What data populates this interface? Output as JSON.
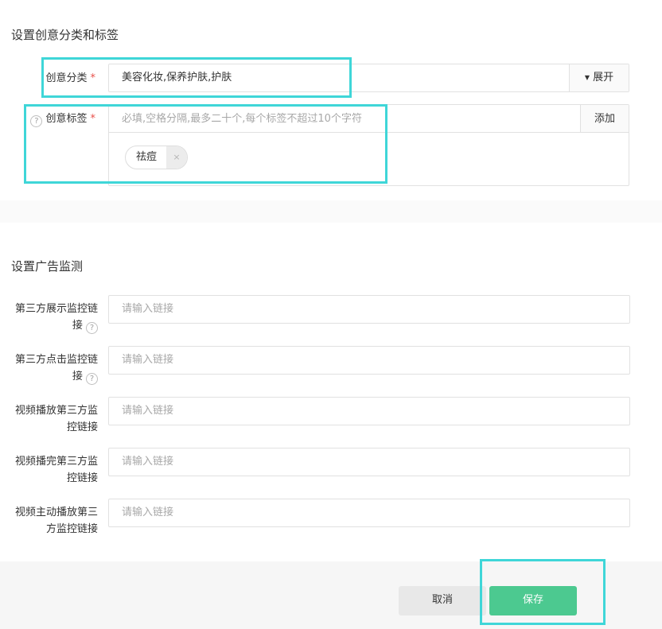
{
  "section1": {
    "title": "设置创意分类和标签",
    "category": {
      "label": "创意分类",
      "required_mark": "*",
      "value": "美容化妆,保养护肤,护肤",
      "expand_label": "展开"
    },
    "tags": {
      "label": "创意标签",
      "required_mark": "*",
      "help_icon": "question-circle-icon",
      "placeholder": "必填,空格分隔,最多二十个,每个标签不超过10个字符",
      "add_label": "添加",
      "items": [
        {
          "text": "祛痘",
          "remove_glyph": "×"
        }
      ]
    }
  },
  "section2": {
    "title": "设置广告监测",
    "fields": [
      {
        "label_line1": "第三方展示监控链",
        "label_line2": "接",
        "has_help": true,
        "placeholder": "请输入链接"
      },
      {
        "label_line1": "第三方点击监控链",
        "label_line2": "接",
        "has_help": true,
        "placeholder": "请输入链接"
      },
      {
        "label_line1": "视频播放第三方监",
        "label_line2": "控链接",
        "has_help": false,
        "placeholder": "请输入链接"
      },
      {
        "label_line1": "视频播完第三方监",
        "label_line2": "控链接",
        "has_help": false,
        "placeholder": "请输入链接"
      },
      {
        "label_line1": "视频主动播放第三",
        "label_line2": "方监控链接",
        "has_help": false,
        "placeholder": "请输入链接"
      }
    ]
  },
  "footer": {
    "cancel_label": "取消",
    "save_label": "保存"
  },
  "colors": {
    "primary": "#4cc990",
    "highlight": "#3fd6d8",
    "required": "#e8504a",
    "cancel_bg": "#e8e8e8"
  }
}
